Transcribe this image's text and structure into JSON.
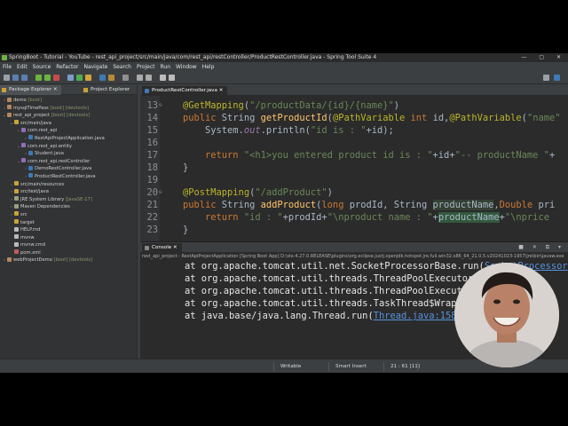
{
  "window": {
    "title": "SpringBoot - Tutorial - YouTube - rest_api_project/src/main/java/com/rest_api/restController/ProductRestController.java - Spring Tool Suite 4",
    "controls": "— ▢ ✕"
  },
  "menu": [
    "File",
    "Edit",
    "Source",
    "Refactor",
    "Navigate",
    "Search",
    "Project",
    "Run",
    "Window",
    "Help"
  ],
  "explorer": {
    "tab_active": "Package Explorer",
    "tab_other": "Project Explorer",
    "items": [
      {
        "label": "demo",
        "suffix": " [boot]",
        "depth": 0,
        "arrow": "›",
        "icon": "#b8865b"
      },
      {
        "label": "mysqlTimePass",
        "suffix": " [boot] [devtools]",
        "depth": 0,
        "arrow": "›",
        "icon": "#b8865b"
      },
      {
        "label": "rest_api_project",
        "suffix": " [boot] [devtools]",
        "depth": 0,
        "arrow": "⌄",
        "icon": "#b8865b"
      },
      {
        "label": "src/main/java",
        "suffix": "",
        "depth": 1,
        "arrow": "⌄",
        "icon": "#c9a33a"
      },
      {
        "label": "com.rest_api",
        "suffix": "",
        "depth": 2,
        "arrow": "⌄",
        "icon": "#8f6fb5"
      },
      {
        "label": "RestApiProjectApplication.java",
        "suffix": "",
        "depth": 3,
        "arrow": "›",
        "icon": "#3d7ab6"
      },
      {
        "label": "com.rest_api.entity",
        "suffix": "",
        "depth": 2,
        "arrow": "⌄",
        "icon": "#8f6fb5"
      },
      {
        "label": "Student.java",
        "suffix": "",
        "depth": 3,
        "arrow": "›",
        "icon": "#3d7ab6"
      },
      {
        "label": "com.rest_api.restController",
        "suffix": "",
        "depth": 2,
        "arrow": "⌄",
        "icon": "#8f6fb5"
      },
      {
        "label": "DemoRestController.java",
        "suffix": "",
        "depth": 3,
        "arrow": "›",
        "icon": "#3d7ab6"
      },
      {
        "label": "ProductRestController.java",
        "suffix": "",
        "depth": 3,
        "arrow": "›",
        "icon": "#3d7ab6"
      },
      {
        "label": "src/main/resources",
        "suffix": "",
        "depth": 1,
        "arrow": "›",
        "icon": "#c9a33a"
      },
      {
        "label": "src/test/java",
        "suffix": "",
        "depth": 1,
        "arrow": "›",
        "icon": "#c9a33a"
      },
      {
        "label": "JRE System Library",
        "suffix": " [JavaSE-17]",
        "depth": 1,
        "arrow": "›",
        "icon": "#9aa07a"
      },
      {
        "label": "Maven Dependencies",
        "suffix": "",
        "depth": 1,
        "arrow": "›",
        "icon": "#9aa07a"
      },
      {
        "label": "src",
        "suffix": "",
        "depth": 1,
        "arrow": "›",
        "icon": "#c9a33a"
      },
      {
        "label": "target",
        "suffix": "",
        "depth": 1,
        "arrow": "",
        "icon": "#c9a33a"
      },
      {
        "label": "HELP.md",
        "suffix": "",
        "depth": 1,
        "arrow": "",
        "icon": "#bbbbbb"
      },
      {
        "label": "mvnw",
        "suffix": "",
        "depth": 1,
        "arrow": "",
        "icon": "#bbbbbb"
      },
      {
        "label": "mvnw.cmd",
        "suffix": "",
        "depth": 1,
        "arrow": "",
        "icon": "#bbbbbb"
      },
      {
        "label": "pom.xml",
        "suffix": "",
        "depth": 1,
        "arrow": "",
        "icon": "#c65b5b"
      },
      {
        "label": "webProjectDemo",
        "suffix": " [boot] [devtools]",
        "depth": 0,
        "arrow": "›",
        "icon": "#b8865b"
      }
    ]
  },
  "editor": {
    "tab_label": "ProductRestController.java",
    "lines": [
      {
        "n": "13",
        "html": "<span class=\"ann\">@GetMapping</span>(<span class=\"str\">\"/productData/{id}/{name}\"</span>)"
      },
      {
        "n": "14",
        "html": "<span class=\"kw\">public</span> String <span class=\"fn\">getProductId</span>(<span class=\"ann\">@PathVariable</span> <span class=\"kw\">int</span> id,<span class=\"ann\">@PathVariable</span>(<span class=\"str\">\"name\"</span>"
      },
      {
        "n": "15",
        "html": "    System.<span class=\"fld\">out</span>.println(<span class=\"str\">\"id is : \"</span>+id);"
      },
      {
        "n": "16",
        "html": ""
      },
      {
        "n": "17",
        "html": "    <span class=\"kw\">return</span> <span class=\"str\">\"&lt;h1&gt;you entered product id is : \"</span>+id+<span class=\"str\">\"-- productName \"</span>+"
      },
      {
        "n": "18",
        "html": "}"
      },
      {
        "n": "19",
        "html": ""
      },
      {
        "n": "20",
        "html": "<span class=\"ann\">@PostMapping</span>(<span class=\"str\">\"/addProduct\"</span>)"
      },
      {
        "n": "21",
        "html": "<span class=\"kw\">public</span> String <span class=\"fn\">addProduct</span>(<span class=\"kw\">long</span> prodId, String <span class=\"hl\">productName</span>,<span class=\"kw\">Double</span> pri"
      },
      {
        "n": "22",
        "html": "    <span class=\"kw\">return</span> <span class=\"str\">\"id : \"</span>+prodId+<span class=\"str\">\"\\nproduct name : \"</span>+<span class=\"hl2\">productName</span>+<span class=\"str\">\"\\nprice</span>"
      },
      {
        "n": "23",
        "html": "}"
      }
    ]
  },
  "console": {
    "tab_label": "Console",
    "header": "rest_api_project - RestApiProjectApplication [Spring Boot App] D:\\sts-4.27.0.RELEASE\\plugins\\org.eclipse.justj.openjdk.hotspot.jre.full.win32.x86_64_21.0.5.v20241023-1957\\jre\\bin\\javaw.exe",
    "lines": [
      {
        "text": "at org.apache.tomcat.util.net.SocketProcessorBase.run(",
        "link": "SocketProcessor"
      },
      {
        "text": "at org.apache.tomcat.util.threads.ThreadPoolExecutor",
        "link": ""
      },
      {
        "text": "at org.apache.tomcat.util.threads.ThreadPoolExecuto",
        "link": ""
      },
      {
        "text": "at org.apache.tomcat.util.threads.TaskThread$Wrapp",
        "link": ""
      },
      {
        "text": "at java.base/java.lang.Thread.run(",
        "link": "Thread.java:1583"
      }
    ]
  },
  "status": {
    "mode": "Writable",
    "insert": "Smart Insert",
    "position": "21 : 61 [11]"
  }
}
